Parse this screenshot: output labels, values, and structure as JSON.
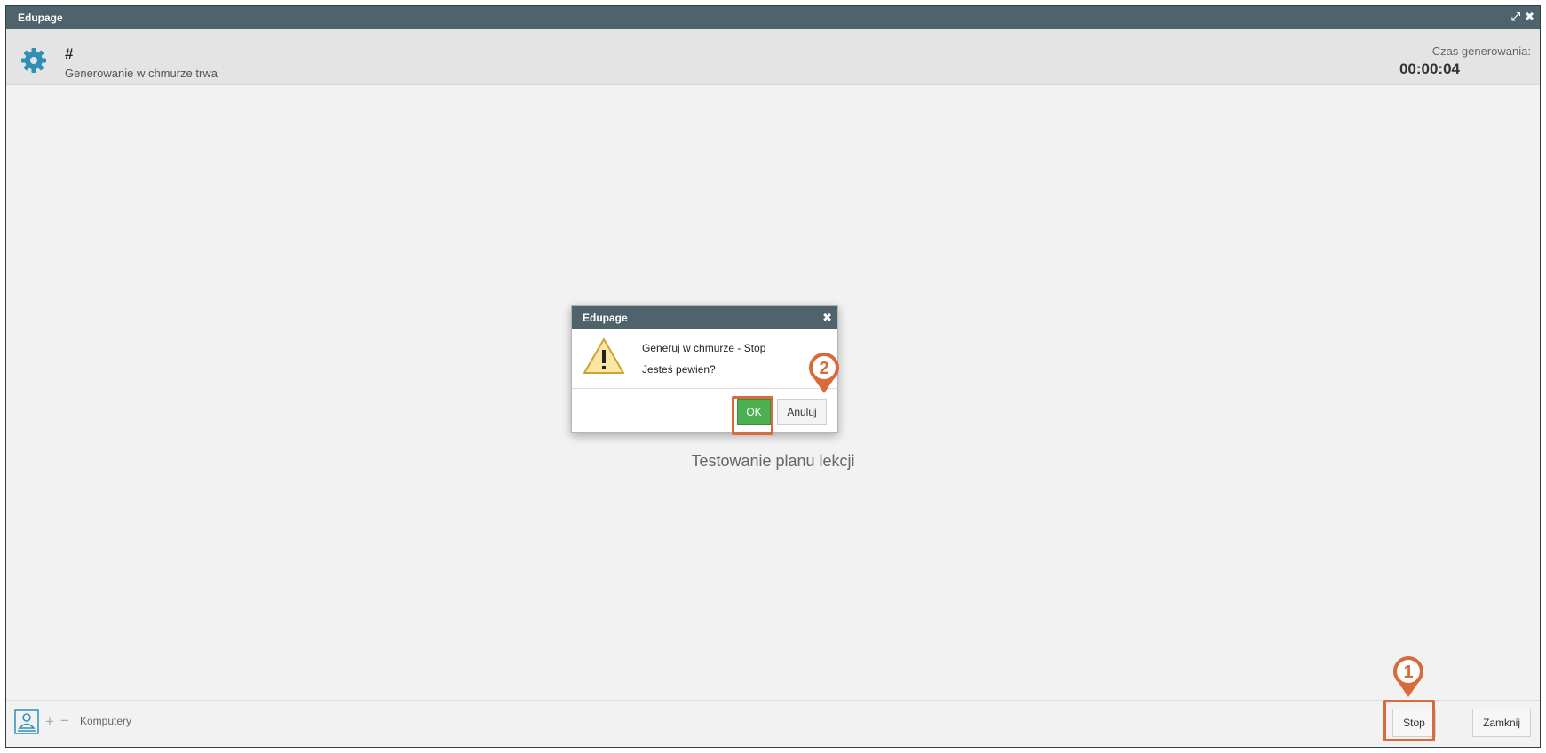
{
  "window": {
    "title": "Edupage",
    "maximize_icon": "⤢",
    "close_icon": "✖"
  },
  "header": {
    "name": "#",
    "status": "Generowanie w chmurze trwa",
    "timer_label": "Czas generowania:",
    "timer_value": "00:00:04"
  },
  "main": {
    "center_text": "Testowanie planu lekcji"
  },
  "dialog": {
    "title": "Edupage",
    "close_icon": "✖",
    "message": "Generuj w chmurze - Stop",
    "question": "Jesteś pewien?",
    "ok_label": "OK",
    "cancel_label": "Anuluj"
  },
  "footer": {
    "plus_icon": "+",
    "minus_icon": "−",
    "computers_label": "Komputery",
    "stop_label": "Stop",
    "close_label": "Zamknij"
  },
  "callouts": {
    "one": "1",
    "two": "2",
    "color": "#d96a3b"
  },
  "colors": {
    "titlebar": "#4f636c",
    "accent_teal": "#2f8fb5",
    "ok_green": "#4caf50"
  }
}
